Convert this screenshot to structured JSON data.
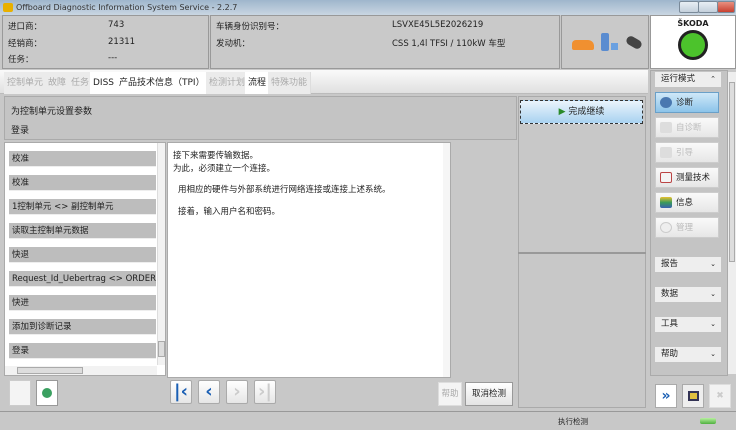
{
  "window": {
    "title": "Offboard Diagnostic Information System Service - 2.2.7"
  },
  "header": {
    "importer_label": "进口商：",
    "importer_value": "743",
    "dealer_label": "经销商：",
    "dealer_value": "21311",
    "task_label": "任务：",
    "task_value": "---",
    "vin_label": "车辆身份识别号：",
    "vin_value": "LSVXE45L5E2026219",
    "engine_label": "发动机：",
    "engine_value": "CSS 1,4l TFSI / 110kW 车型",
    "brand": "ŠKODA"
  },
  "tabs": [
    {
      "label": "控制单元",
      "active": false
    },
    {
      "label": "故障",
      "active": false
    },
    {
      "label": "任务",
      "active": false
    },
    {
      "label": "DISS",
      "active": true
    },
    {
      "label": "产品技术信息（TPI）",
      "active": true
    },
    {
      "label": "检测计划",
      "active": false
    },
    {
      "label": "流程",
      "active": true
    },
    {
      "label": "特殊功能",
      "active": false
    }
  ],
  "procedure": {
    "title": "为控制单元设置参数",
    "subtitle": "登录"
  },
  "steps": [
    "校准",
    "校准",
    "1控制单元 <> 副控制单元",
    "读取主控制单元数据",
    "快退",
    "Request_Id_Uebertrag <> ORDER_R",
    "快进",
    "添加到诊断记录",
    "登录"
  ],
  "message": {
    "line1": "接下来需要传输数据。",
    "line2": "为此，必须建立一个连接。",
    "line3": "用相应的硬件与外部系统进行网络连接或连接上述系统。",
    "line4": "接着，输入用户名和密码。"
  },
  "buttons": {
    "complete_continue": "完成继续",
    "help": "帮助",
    "cancel_test": "取消检测"
  },
  "sidebar": {
    "mode_title": "运行模式",
    "modes": [
      {
        "label": "诊断",
        "state": "active"
      },
      {
        "label": "自诊断",
        "state": "disabled"
      },
      {
        "label": "引导",
        "state": "disabled"
      },
      {
        "label": "测量技术",
        "state": "enabled"
      },
      {
        "label": "信息",
        "state": "enabled"
      },
      {
        "label": "管理",
        "state": "disabled"
      }
    ],
    "groups": [
      "报告",
      "数据",
      "工具",
      "帮助"
    ]
  },
  "status": {
    "text": "执行检测"
  }
}
